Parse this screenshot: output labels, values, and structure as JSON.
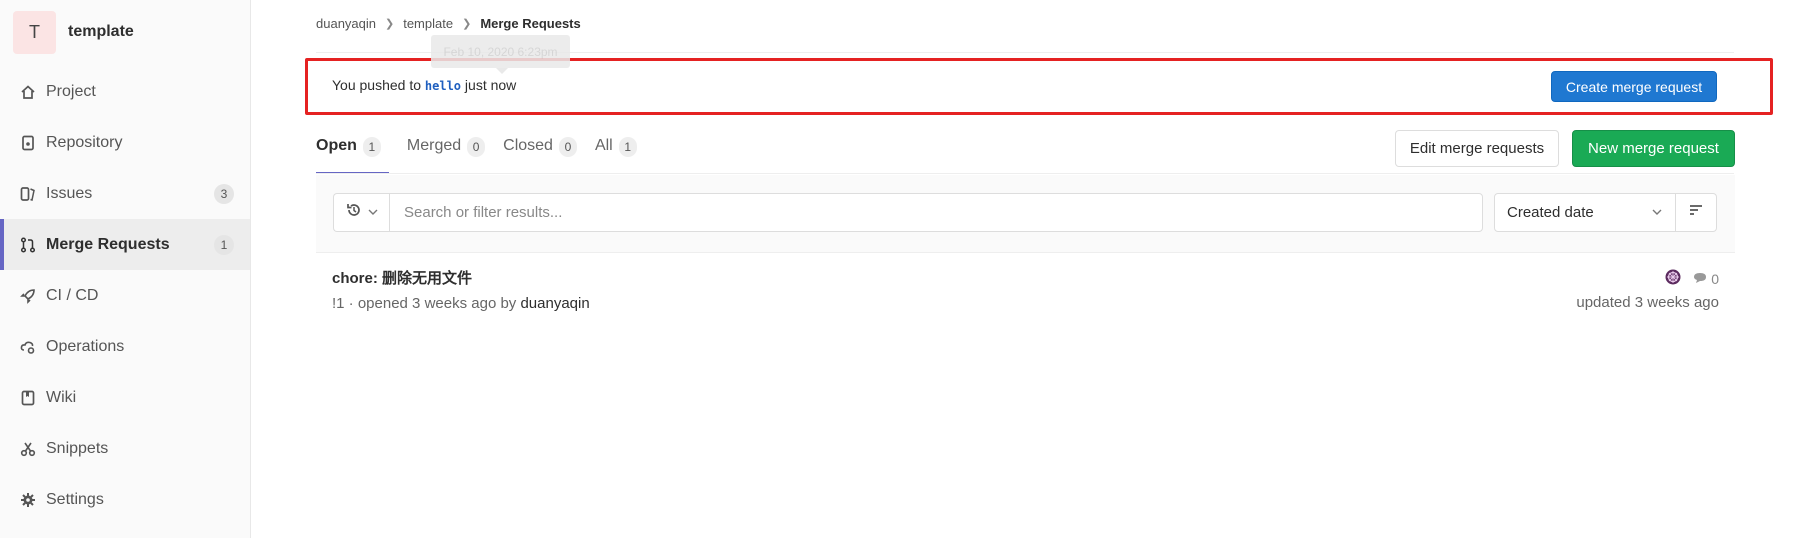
{
  "sidebar": {
    "project_initial": "T",
    "project_name": "template",
    "items": [
      {
        "label": "Project",
        "icon": "home-icon"
      },
      {
        "label": "Repository",
        "icon": "document-icon"
      },
      {
        "label": "Issues",
        "icon": "issues-icon",
        "count": "3"
      },
      {
        "label": "Merge Requests",
        "icon": "merge-request-icon",
        "count": "1",
        "active": true
      },
      {
        "label": "CI / CD",
        "icon": "rocket-icon"
      },
      {
        "label": "Operations",
        "icon": "cloud-gear-icon"
      },
      {
        "label": "Wiki",
        "icon": "book-icon"
      },
      {
        "label": "Snippets",
        "icon": "scissors-icon"
      },
      {
        "label": "Settings",
        "icon": "gear-icon"
      }
    ]
  },
  "breadcrumb": {
    "items": [
      "duanyaqin",
      "template"
    ],
    "current": "Merge Requests"
  },
  "tooltip": {
    "text": "Feb 10, 2020 6:23pm"
  },
  "push_banner": {
    "prefix": "You pushed to",
    "branch": "hello",
    "suffix": "just now",
    "button_label": "Create merge request"
  },
  "tabs": [
    {
      "label": "Open",
      "count": "1",
      "active": true
    },
    {
      "label": "Merged",
      "count": "0"
    },
    {
      "label": "Closed",
      "count": "0"
    },
    {
      "label": "All",
      "count": "1"
    }
  ],
  "actions": {
    "edit_label": "Edit merge requests",
    "new_label": "New merge request"
  },
  "filter": {
    "placeholder": "Search or filter results...",
    "sort_label": "Created date"
  },
  "merge_requests": [
    {
      "title": "chore: 删除无用文件",
      "meta_prefix": "!1 · opened 3 weeks ago by",
      "author": "duanyaqin",
      "comments": "0",
      "updated": "updated 3 weeks ago"
    }
  ],
  "colors": {
    "accent": "#6666c4",
    "primary_button": "#1f78d1",
    "success_button": "#1aaa55",
    "highlight_border": "#e52222"
  }
}
